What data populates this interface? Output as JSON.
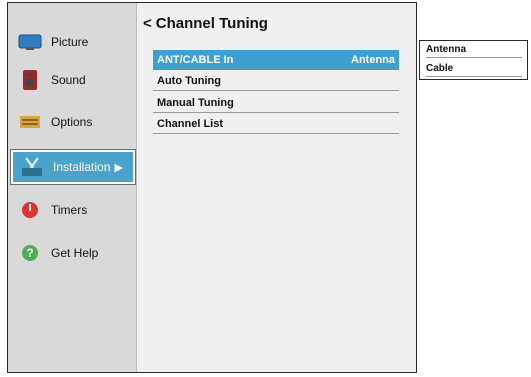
{
  "sidebar": {
    "items": [
      {
        "label": "Picture",
        "icon": "picture-icon"
      },
      {
        "label": "Sound",
        "icon": "speaker-icon"
      },
      {
        "label": "Options",
        "icon": "options-icon"
      },
      {
        "label": "Installation",
        "icon": "installation-icon"
      },
      {
        "label": "Timers",
        "icon": "timer-icon"
      },
      {
        "label": "Get Help",
        "icon": "help-icon"
      }
    ],
    "active_arrow": "▶"
  },
  "main": {
    "back_glyph": "<",
    "title": "Channel Tuning",
    "rows": [
      {
        "label": "ANT/CABLE In",
        "value": "Antenna"
      },
      {
        "label": "Auto Tuning",
        "value": ""
      },
      {
        "label": "Manual Tuning",
        "value": ""
      },
      {
        "label": "Channel List",
        "value": ""
      }
    ]
  },
  "dropdown": {
    "options": [
      "Antenna",
      "Cable"
    ]
  },
  "colors": {
    "accent": "#3f9fd0",
    "sidebar_bg": "#d9d9d9",
    "active_nav": "#4aa3c9"
  }
}
